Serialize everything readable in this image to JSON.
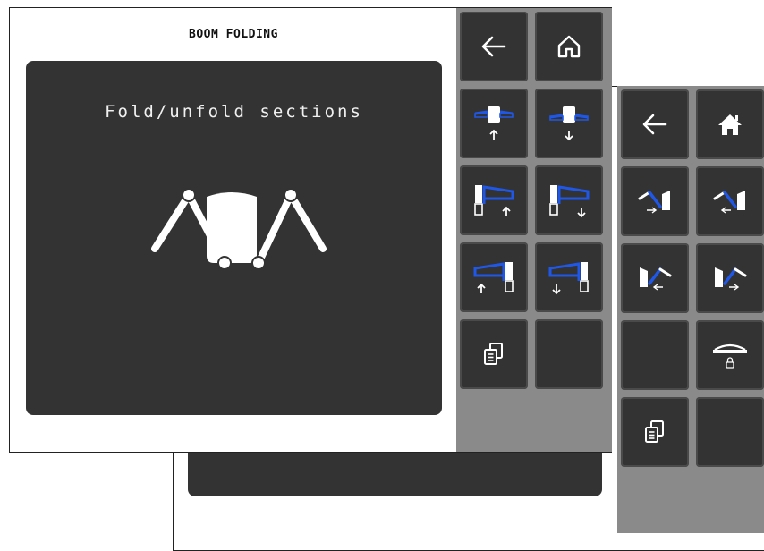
{
  "front_screen": {
    "title": "BOOM FOLDING",
    "content_caption": "Fold/unfold sections",
    "panel_icons": [
      "back-arrow-icon",
      "home-outline-icon",
      "center-boom-raise-icon",
      "center-boom-lower-icon",
      "left-wing-raise-icon",
      "left-wing-lower-icon",
      "right-wing-raise-icon",
      "right-wing-lower-icon",
      "copy-pages-icon"
    ]
  },
  "back_screen": {
    "panel_icons": [
      "back-arrow-icon",
      "home-filled-icon",
      "fold-left-in-icon",
      "unfold-left-out-icon",
      "fold-right-in-icon",
      "unfold-right-out-icon",
      "boom-lock-icon",
      "copy-pages-icon"
    ]
  },
  "colors": {
    "panel_bg": "#8a8a8a",
    "button_bg": "#333333",
    "accent_blue": "#1f57e8",
    "content_bg": "#333333"
  }
}
